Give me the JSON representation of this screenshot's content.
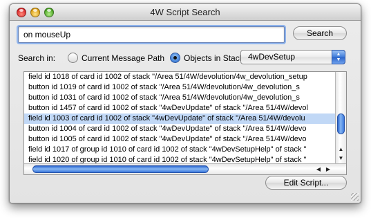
{
  "window": {
    "title": "4W Script Search"
  },
  "search": {
    "query": "on mouseUp",
    "button_label": "Search"
  },
  "scope": {
    "label": "Search in:",
    "option_current": "Current Message Path",
    "option_objects": "Objects in Stack:",
    "selected": "Objects in Stack:",
    "stack_popup_value": "4wDevSetup"
  },
  "results": {
    "rows": [
      "field id 1018 of card id 1002 of stack \"/Area 51/4W/devolution/4w_devolution_setup",
      "button id 1019 of card id 1002 of stack \"/Area 51/4W/devolution/4w_devolution_s",
      "button id 1031 of card id 1002 of stack \"/Area 51/4W/devolution/4w_devolution_s",
      "button id 1457 of card id 1002 of stack \"4wDevUpdate\" of stack \"/Area 51/4W/devol",
      "field id 1003 of card id 1002 of stack \"4wDevUpdate\" of stack \"/Area 51/4W/devolu",
      "button id 1004 of card id 1002 of stack \"4wDevUpdate\" of stack \"/Area 51/4W/devo",
      "button id 1005 of card id 1002 of stack \"4wDevUpdate\" of stack \"/Area 51/4W/devo",
      "field id 1017 of group id 1010 of card id 1002 of stack \"4wDevSetupHelp\" of stack \"",
      "field id 1020 of group id 1010 of card id 1002 of stack \"4wDevSetupHelp\" of stack \""
    ],
    "selected_index": 4
  },
  "actions": {
    "edit_label": "Edit Script..."
  },
  "colors": {
    "selection": "#c1d8f6",
    "accent": "#3d7ad9"
  }
}
